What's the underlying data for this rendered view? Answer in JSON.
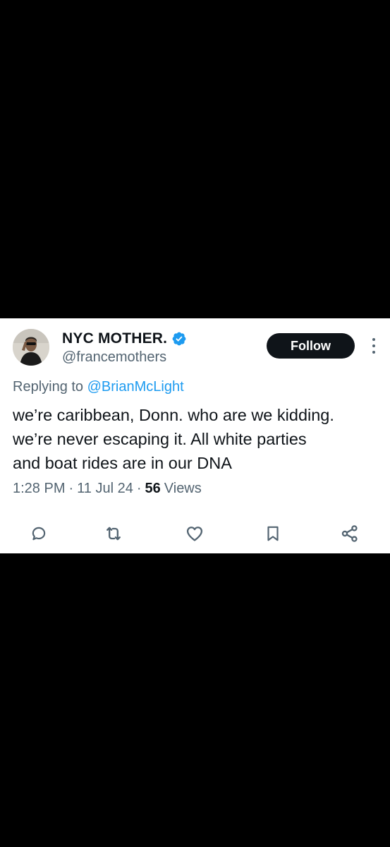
{
  "tweet": {
    "display_name": "NYC MOTHER.",
    "handle": "@francemothers",
    "follow_label": "Follow",
    "replying_prefix": "Replying to",
    "replying_to": "@BrianMcLight",
    "text_lines": [
      "we’re caribbean, Donn. who are we kidding.",
      "we’re never escaping it. All white parties",
      "and boat rides are in our DNA"
    ],
    "time": "1:28 PM",
    "date": "11 Jul 24",
    "views_count": "56",
    "views_label": "Views",
    "separator": "·"
  },
  "icons": {
    "verified": "verified-badge-icon",
    "more": "more-vertical-icon",
    "reply": "reply-icon",
    "retweet": "retweet-icon",
    "like": "like-icon",
    "bookmark": "bookmark-icon",
    "share": "share-icon"
  },
  "colors": {
    "background": "#000000",
    "card": "#ffffff",
    "text": "#0f1419",
    "secondary_text": "#536471",
    "accent": "#1d9bf0",
    "follow_button": "#0f1419"
  }
}
